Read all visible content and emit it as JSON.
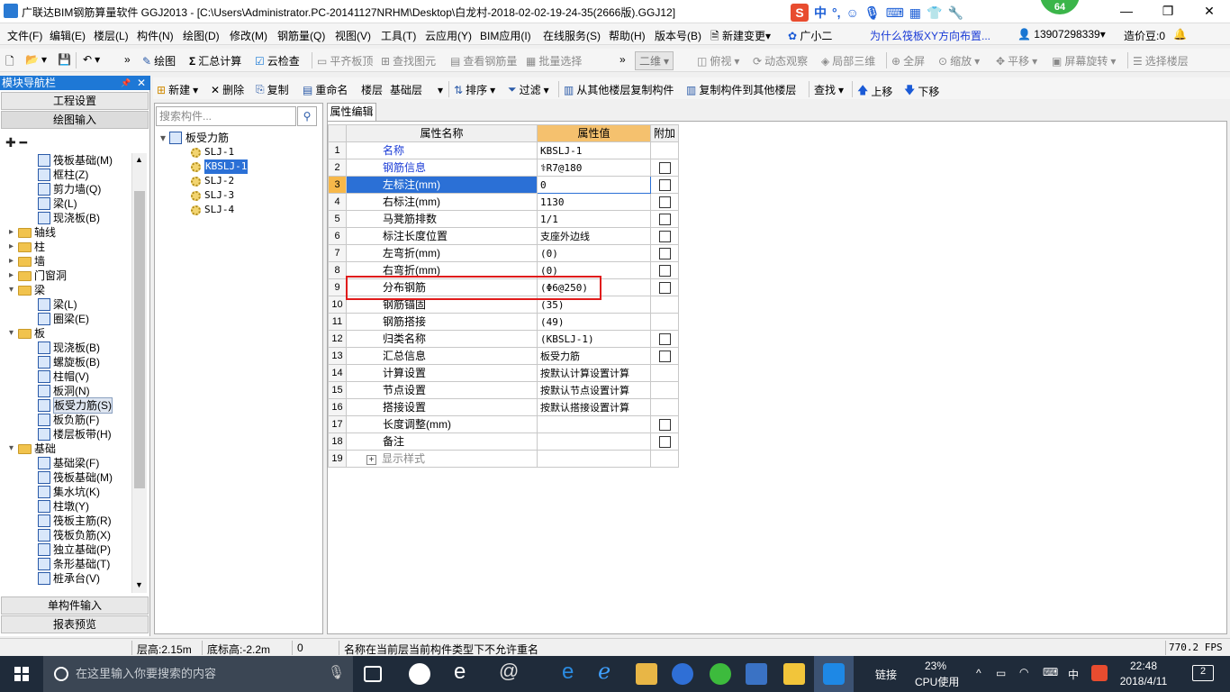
{
  "window": {
    "title": "广联达BIM钢筋算量软件 GGJ2013 - [C:\\Users\\Administrator.PC-20141127NRHM\\Desktop\\白龙村-2018-02-02-19-24-35(2666版).GGJ12]",
    "badge": "64",
    "ime_label": "中",
    "ime_punct": "°,",
    "controls": {
      "minimize": "—",
      "restore": "❐",
      "close": "✕"
    }
  },
  "menubar": {
    "items": [
      "文件(F)",
      "编辑(E)",
      "楼层(L)",
      "构件(N)",
      "绘图(D)",
      "修改(M)",
      "钢筋量(Q)",
      "视图(V)",
      "工具(T)",
      "云应用(Y)",
      "BIM应用(I)",
      "在线服务(S)",
      "帮助(H)",
      "版本号(B)"
    ],
    "new_change": "新建变更",
    "new_change_arrow": "▾",
    "assistant": "广小二",
    "question": "为什么筏板XY方向布置...",
    "phone": "13907298339",
    "phone_arrow": "▾",
    "bean": "造价豆:0",
    "bell": "🔔"
  },
  "toolbar1": {
    "dropdown_arrow": "▾",
    "more": "»",
    "draw": "绘图",
    "sum": "汇总计算",
    "sum_icon": "Σ",
    "cloud_check": "云检查",
    "level_top": "平齐板顶",
    "find_elem": "查找图元",
    "view_rebar": "查看钢筋量",
    "batch_select": "批量选择",
    "view_mode": "二维",
    "top_view": "俯视",
    "dyn_view": "动态观察",
    "local_3d": "局部三维",
    "fullscreen": "全屏",
    "zoom": "缩放",
    "pan": "平移",
    "rotate": "屏幕旋转",
    "select_floor": "选择楼层"
  },
  "toolbar2": {
    "new": "新建",
    "delete": "删除",
    "copy": "复制",
    "rename": "重命名",
    "floor_label": "楼层",
    "floor_value": "基础层",
    "sort": "排序",
    "filter": "过滤",
    "copy_from": "从其他楼层复制构件",
    "copy_to": "复制构件到其他楼层",
    "find": "查找",
    "up": "上移",
    "down": "下移",
    "up_arrow": "🡅",
    "down_arrow": "🡇"
  },
  "navpanel": {
    "header": "模块导航栏",
    "pin": "📌",
    "close": "✕",
    "project_settings": "工程设置",
    "draw_input": "绘图输入",
    "single_input": "单构件输入",
    "report_preview": "报表预览",
    "tree": [
      {
        "label": "筏板基础(M)",
        "level": 2
      },
      {
        "label": "框柱(Z)",
        "level": 2
      },
      {
        "label": "剪力墙(Q)",
        "level": 2
      },
      {
        "label": "梁(L)",
        "level": 2
      },
      {
        "label": "现浇板(B)",
        "level": 2
      },
      {
        "label": "轴线",
        "level": 1,
        "folder": true,
        "exp": "▸"
      },
      {
        "label": "柱",
        "level": 1,
        "folder": true,
        "exp": "▸"
      },
      {
        "label": "墙",
        "level": 1,
        "folder": true,
        "exp": "▸"
      },
      {
        "label": "门窗洞",
        "level": 1,
        "folder": true,
        "exp": "▸"
      },
      {
        "label": "梁",
        "level": 1,
        "folder": true,
        "exp": "▾"
      },
      {
        "label": "梁(L)",
        "level": 2
      },
      {
        "label": "圈梁(E)",
        "level": 2
      },
      {
        "label": "板",
        "level": 1,
        "folder": true,
        "exp": "▾"
      },
      {
        "label": "现浇板(B)",
        "level": 2
      },
      {
        "label": "螺旋板(B)",
        "level": 2
      },
      {
        "label": "柱帽(V)",
        "level": 2
      },
      {
        "label": "板洞(N)",
        "level": 2
      },
      {
        "label": "板受力筋(S)",
        "level": 2,
        "selected": true
      },
      {
        "label": "板负筋(F)",
        "level": 2
      },
      {
        "label": "楼层板带(H)",
        "level": 2
      },
      {
        "label": "基础",
        "level": 1,
        "folder": true,
        "exp": "▾"
      },
      {
        "label": "基础梁(F)",
        "level": 2
      },
      {
        "label": "筏板基础(M)",
        "level": 2
      },
      {
        "label": "集水坑(K)",
        "level": 2
      },
      {
        "label": "柱墩(Y)",
        "level": 2
      },
      {
        "label": "筏板主筋(R)",
        "level": 2
      },
      {
        "label": "筏板负筋(X)",
        "level": 2
      },
      {
        "label": "独立基础(P)",
        "level": 2
      },
      {
        "label": "条形基础(T)",
        "level": 2
      },
      {
        "label": "桩承台(V)",
        "level": 2
      }
    ],
    "scroll_up": "▲",
    "scroll_down": "▼"
  },
  "listpanel": {
    "search_placeholder": "搜索构件...",
    "search_icon": "⚲",
    "root": "板受力筋",
    "root_exp": "▾",
    "items": [
      "SLJ-1",
      "KBSLJ-1",
      "SLJ-2",
      "SLJ-3",
      "SLJ-4"
    ],
    "selected_index": 1
  },
  "props": {
    "tab": "属性编辑",
    "headers": {
      "name": "属性名称",
      "value": "属性值",
      "extra": "附加"
    },
    "rows": [
      {
        "n": "1",
        "name": "名称",
        "value": "KBSLJ-1",
        "cb": false,
        "blue": true
      },
      {
        "n": "2",
        "name": "钢筋信息",
        "value": "⚕R7@180",
        "cb": true,
        "blue": true
      },
      {
        "n": "3",
        "name": "左标注(mm)",
        "value": "0",
        "cb": true,
        "selected": true
      },
      {
        "n": "4",
        "name": "右标注(mm)",
        "value": "1130",
        "cb": true
      },
      {
        "n": "5",
        "name": "马凳筋排数",
        "value": "1/1",
        "cb": true
      },
      {
        "n": "6",
        "name": "标注长度位置",
        "value": "支座外边线",
        "cb": true
      },
      {
        "n": "7",
        "name": "左弯折(mm)",
        "value": "(0)",
        "cb": true
      },
      {
        "n": "8",
        "name": "右弯折(mm)",
        "value": "(0)",
        "cb": true
      },
      {
        "n": "9",
        "name": "分布钢筋",
        "value": "(Φ6@250)",
        "cb": true
      },
      {
        "n": "10",
        "name": "钢筋锚固",
        "value": "(35)",
        "cb": false
      },
      {
        "n": "11",
        "name": "钢筋搭接",
        "value": "(49)",
        "cb": false
      },
      {
        "n": "12",
        "name": "归类名称",
        "value": "(KBSLJ-1)",
        "cb": true
      },
      {
        "n": "13",
        "name": "汇总信息",
        "value": "板受力筋",
        "cb": true
      },
      {
        "n": "14",
        "name": "计算设置",
        "value": "按默认计算设置计算",
        "cb": false
      },
      {
        "n": "15",
        "name": "节点设置",
        "value": "按默认节点设置计算",
        "cb": false
      },
      {
        "n": "16",
        "name": "搭接设置",
        "value": "按默认搭接设置计算",
        "cb": false
      },
      {
        "n": "17",
        "name": "长度调整(mm)",
        "value": "",
        "cb": true
      },
      {
        "n": "18",
        "name": "备注",
        "value": "",
        "cb": true
      },
      {
        "n": "19",
        "name": "显示样式",
        "value": "",
        "cb": false,
        "gray": true,
        "plus": "+"
      }
    ]
  },
  "statusbar": {
    "floor_height": "层高:2.15m",
    "bottom_height": "底标高:-2.2m",
    "zero": "0",
    "message": "名称在当前层当前构件类型下不允许重名",
    "fps": "770.2 FPS"
  },
  "taskbar": {
    "search_placeholder": "在这里输入你要搜索的内容",
    "link": "链接",
    "cpu_pct": "23%",
    "cpu_label": "CPU使用",
    "ime": "中",
    "time": "22:48",
    "date": "2018/4/11",
    "notif": "2",
    "tray_chevron": "^"
  }
}
